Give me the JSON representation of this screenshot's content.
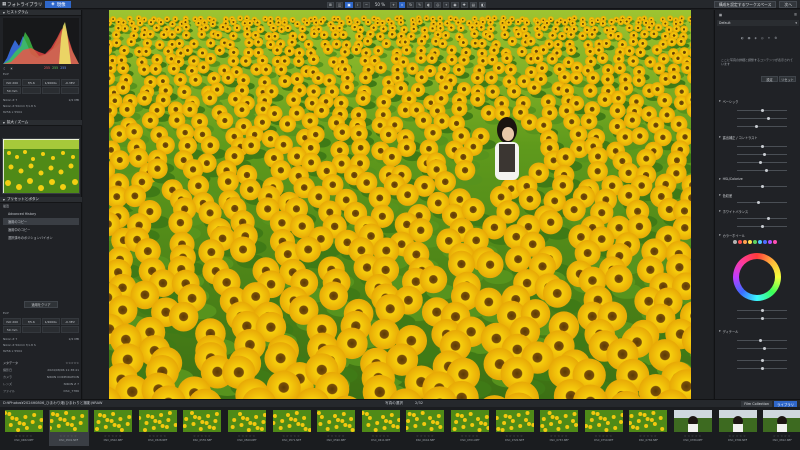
{
  "topbar": {
    "app_title": "フォトライブラリ",
    "active_tab": "現像",
    "zoom": "50 %",
    "right_buttons": [
      "構成を設定するワークスペース",
      "次へ"
    ]
  },
  "left_panel": {
    "histogram_header": "ヒストグラム",
    "rgb": {
      "r": "255",
      "g": "255",
      "b": "255"
    },
    "exif_section": "Exif",
    "exif_cells": [
      "ISO 200",
      "f/5.6",
      "1/2000s",
      "-0.3EV",
      "50 mm",
      "",
      "",
      ""
    ],
    "exif_kv": [
      {
        "k": "Nikon Z 7",
        "v": "2/2 MB"
      },
      {
        "k": "Nikon Z 50mm f/1.8 S",
        "v": ""
      },
      {
        "k": "8256 x 5504",
        "v": ""
      }
    ],
    "navigator_header": "拡大 / ズーム",
    "presets_header": "プリセットとボタン",
    "presets_sub": "最近",
    "preset_items": [
      "Advanced History",
      "適用のコピー",
      "適用中のコピー",
      "選択済みのポジションバイオン"
    ],
    "apply_button": "適用をクリア",
    "exif2_section": "Exif",
    "meta_header": "メタデータ",
    "meta_rows": [
      {
        "k": "撮影日",
        "v": "2024/08/06 11:38:41"
      },
      {
        "k": "カメラ",
        "v": "NIKON CORPORATION"
      },
      {
        "k": "レンズ",
        "v": "NIKON Z 7"
      },
      {
        "k": "ファイル",
        "v": "DSC_7786"
      }
    ]
  },
  "right_panel": {
    "top_dropdown": "Default",
    "info_text": "ここに写真の詳細と調整するコンテンツが表示されています",
    "buttons": [
      "設定",
      "リセット"
    ],
    "sections": [
      "ベーシック",
      "露出補正 / コントラスト",
      "トーン",
      "HSL/Colorize",
      "色収差",
      "ホワイトバランス",
      "カラーホイール",
      "ディテール"
    ],
    "colors": [
      "#b4b4b4",
      "#ff4f4f",
      "#ffa04f",
      "#ffe04f",
      "#5fd35f",
      "#4fc6ff",
      "#4f6bff",
      "#b04fff",
      "#ff4fb4"
    ]
  },
  "filmstrip": {
    "path": "D:¥Photos¥2024¥0806_ひまわり畑(ひまわりと撮影)¥RAW",
    "center_label": "写真の選択",
    "count": "2/32",
    "right_tabs": [
      "Film Collection",
      "ライブラリ"
    ],
    "thumbs": [
      "DSC_0482.NEF",
      "DSC_0501.NEF",
      "DSC_0502.NEF",
      "DSC_0528.NEF",
      "DSC_0555.NEF",
      "DSC_0560.NEF",
      "DSC_0571.NEF",
      "DSC_0590.NEF",
      "DSC_0611.NEF",
      "DSC_0644.NEF",
      "DSC_0701.NEF",
      "DSC_0720.NEF",
      "DSC_0733.NEF",
      "DSC_0750.NEF",
      "DSC_0784.NEF",
      "DSC_0786.NEF",
      "DSC_0790.NEF",
      "DSC_0812.NEF"
    ],
    "selected_index": 1
  }
}
